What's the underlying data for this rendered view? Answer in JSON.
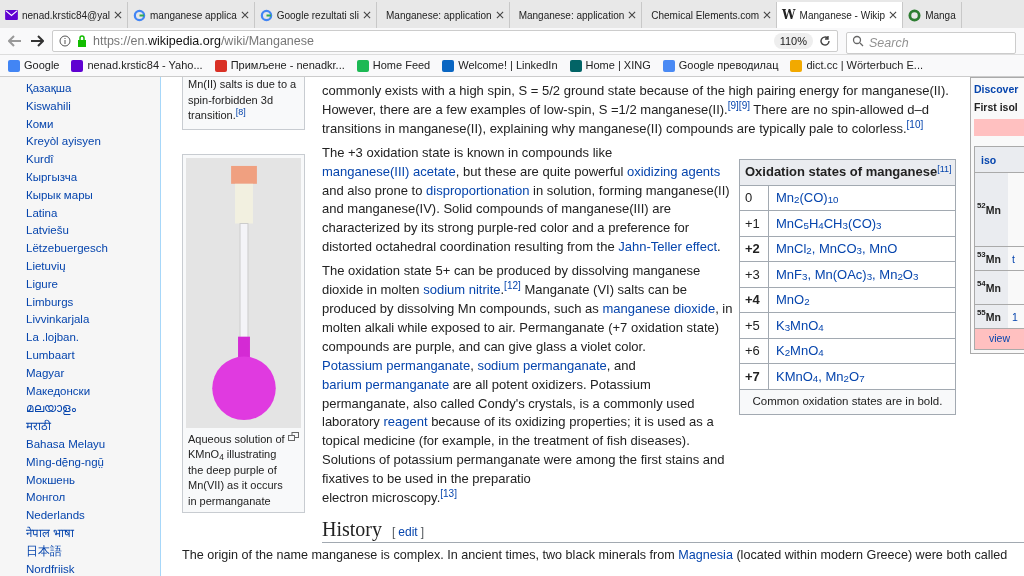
{
  "browser": {
    "tabs": [
      {
        "kind": "mail",
        "title": "nenad.krstic84@yal",
        "selected": false
      },
      {
        "kind": "google",
        "title": "manganese applica",
        "selected": false
      },
      {
        "kind": "google",
        "title": "Google rezultati sli",
        "selected": false
      },
      {
        "kind": "plain",
        "title": "Manganese: application",
        "selected": false
      },
      {
        "kind": "plain",
        "title": "Manganese: application",
        "selected": false
      },
      {
        "kind": "plain",
        "title": "Chemical Elements.com",
        "selected": false
      },
      {
        "kind": "letter",
        "glyph": "W",
        "title": "Manganese - Wikip",
        "selected": true
      },
      {
        "kind": "ring",
        "title": "Manga",
        "selected": false
      }
    ],
    "url_prefix": "https://en.",
    "url_domain": "wikipedia.org",
    "url_path": "/wiki/Manganese",
    "zoom": "110%",
    "search_placeholder": "Search",
    "bookmarks": [
      {
        "kind": "google",
        "label": "Google"
      },
      {
        "kind": "mail",
        "label": "nenad.krstic84 - Yaho..."
      },
      {
        "kind": "gmail",
        "label": "Примљене - nenadkr..."
      },
      {
        "kind": "green",
        "label": "Home Feed"
      },
      {
        "kind": "blue",
        "label": "Welcome! | LinkedIn"
      },
      {
        "kind": "xing",
        "label": "Home | XING"
      },
      {
        "kind": "translate",
        "label": "Google преводилац"
      },
      {
        "kind": "orange",
        "label": "dict.cc | Wörterbuch E..."
      }
    ]
  },
  "sidebar": {
    "languages": [
      "Қазақша",
      "Kiswahili",
      "Коми",
      "Kreyòl ayisyen",
      "Kurdî",
      "Кыргызча",
      "Кырык мары",
      "Latina",
      "Latviešu",
      "Lëtzebuergesch",
      "Lietuvių",
      "Ligure",
      "Limburgs",
      "Livvinkarjala",
      "La .lojban.",
      "Lumbaart",
      "Magyar",
      "Македонски",
      "മലയാളം",
      "मराठी",
      "Bahasa Melayu",
      "Mìng-dĕ̤ng-ngṳ̄",
      "Мокшень",
      "Монгол",
      "Nederlands",
      "नेपाल भाषा",
      "日本語",
      "Nordfriisk"
    ]
  },
  "thumbnails": [
    {
      "kind": "caption",
      "caption": "Mn(II) salts is due to a spin-forbidden 3d transition.",
      "ref": "[8]"
    },
    {
      "kind": "image",
      "caption": "Aqueous solution of KMnO$_{4}$ illustrating the deep purple of Mn(VII) as it occurs in permanganate"
    }
  ],
  "paragraphs": [
    [
      {
        "kind": "text",
        "t": "commonly exists with a high spin, S = 5/2 ground state because of the high pairing energy for manganese(II). However, there are a few examples of low-spin, S =1/2 manganese(II)."
      },
      {
        "kind": "ref",
        "t": "[9]"
      },
      {
        "kind": "ref",
        "t": "[9]"
      },
      {
        "kind": "text",
        "t": " There are no spin-allowed d–d transitions in manganese(II), explaining why manganese(II) compounds are typically pale to colorless."
      },
      {
        "kind": "ref",
        "t": "[10]"
      }
    ],
    [
      {
        "kind": "text",
        "t": "The +3 oxidation state is known in compounds like "
      },
      {
        "kind": "link",
        "t": "manganese(III) acetate"
      },
      {
        "kind": "text",
        "t": ", but these are quite powerful "
      },
      {
        "kind": "link",
        "t": "oxidizing agents"
      },
      {
        "kind": "text",
        "t": " and also prone to "
      },
      {
        "kind": "link",
        "t": "disproportionation"
      },
      {
        "kind": "text",
        "t": " in solution, forming manganese(II) and manganese(IV). Solid compounds of manganese(III) are characterized by its strong purple-red color and a preference for distorted octahedral coordination resulting from the "
      },
      {
        "kind": "link",
        "t": "Jahn-Teller effect"
      },
      {
        "kind": "text",
        "t": "."
      }
    ],
    [
      {
        "kind": "text",
        "t": "The oxidation state 5+ can be produced by dissolving manganese dioxide in molten "
      },
      {
        "kind": "link",
        "t": "sodium nitrite"
      },
      {
        "kind": "text",
        "t": "."
      },
      {
        "kind": "ref",
        "t": "[12]"
      },
      {
        "kind": "text",
        "t": " Manganate (VI) salts can be produced by dissolving Mn compounds, such as "
      },
      {
        "kind": "link",
        "t": "manganese dioxide"
      },
      {
        "kind": "text",
        "t": ", in molten alkali while exposed to air. Permanganate (+7 oxidation state) compounds are purple, and can give glass a violet color. "
      },
      {
        "kind": "link",
        "t": "Potassium permanganate"
      },
      {
        "kind": "text",
        "t": ", "
      },
      {
        "kind": "link",
        "t": "sodium permanganate"
      },
      {
        "kind": "text",
        "t": ", and "
      },
      {
        "kind": "link",
        "t": "barium permanganate"
      },
      {
        "kind": "text",
        "t": " are all potent oxidizers. Potassium permanganate, also called Condy's crystals, is a commonly used laboratory "
      },
      {
        "kind": "link",
        "t": "reagent"
      },
      {
        "kind": "text",
        "t": " because of its oxidizing properties; it is used as a topical medicine (for example, in the treatment of fish diseases). Solutions of potassium permanganate were among the first stains and fixatives to be used in the preparatio"
      },
      {
        "kind": "cut"
      },
      {
        "kind": "text",
        "t": "electron microscopy."
      },
      {
        "kind": "ref",
        "t": "[13]"
      }
    ]
  ],
  "oxidation_table": {
    "title": "Oxidation states of manganese",
    "ref": "[11]",
    "rows": [
      {
        "state": "0",
        "common": false,
        "compounds": "Mn$_{2}$(CO)$_{10}$"
      },
      {
        "state": "+1",
        "common": false,
        "compounds": "MnC$_{5}$H$_{4}$CH$_{3}$(CO)$_{3}$"
      },
      {
        "state": "+2",
        "common": true,
        "compounds": "MnCl$_{2}$, MnCO$_{3}$, MnO"
      },
      {
        "state": "+3",
        "common": false,
        "compounds": "MnF$_{3}$, Mn(OAc)$_{3}$, Mn$_{2}$O$_{3}$"
      },
      {
        "state": "+4",
        "common": true,
        "compounds": "MnO$_{2}$"
      },
      {
        "state": "+5",
        "common": false,
        "compounds": "K$_{3}$MnO$_{4}$"
      },
      {
        "state": "+6",
        "common": false,
        "compounds": "K$_{2}$MnO$_{4}$"
      },
      {
        "state": "+7",
        "common": true,
        "compounds": "KMnO$_{4}$, Mn$_{2}$O$_{7}$"
      }
    ],
    "footer": "Common oxidation states are in bold."
  },
  "infobox": {
    "link": "Discover",
    "label": "First isol",
    "header": "iso",
    "rows": [
      {
        "isotope": "$^{52}$Mn"
      },
      {
        "isotope": "$^{53}$Mn",
        "cell": "t"
      },
      {
        "isotope": "$^{54}$Mn"
      },
      {
        "isotope": "$^{55}$Mn",
        "cell": "1"
      }
    ],
    "footer": "view"
  },
  "history": {
    "heading": "History",
    "edit_open": "[",
    "edit": "edit",
    "edit_close": "]",
    "paragraph": [
      {
        "kind": "text",
        "t": "The origin of the name manganese is complex. In ancient times, two black minerals from "
      },
      {
        "kind": "link",
        "t": "Magnesia"
      },
      {
        "kind": "text",
        "t": " (located within modern Greece) were both called"
      }
    ]
  }
}
